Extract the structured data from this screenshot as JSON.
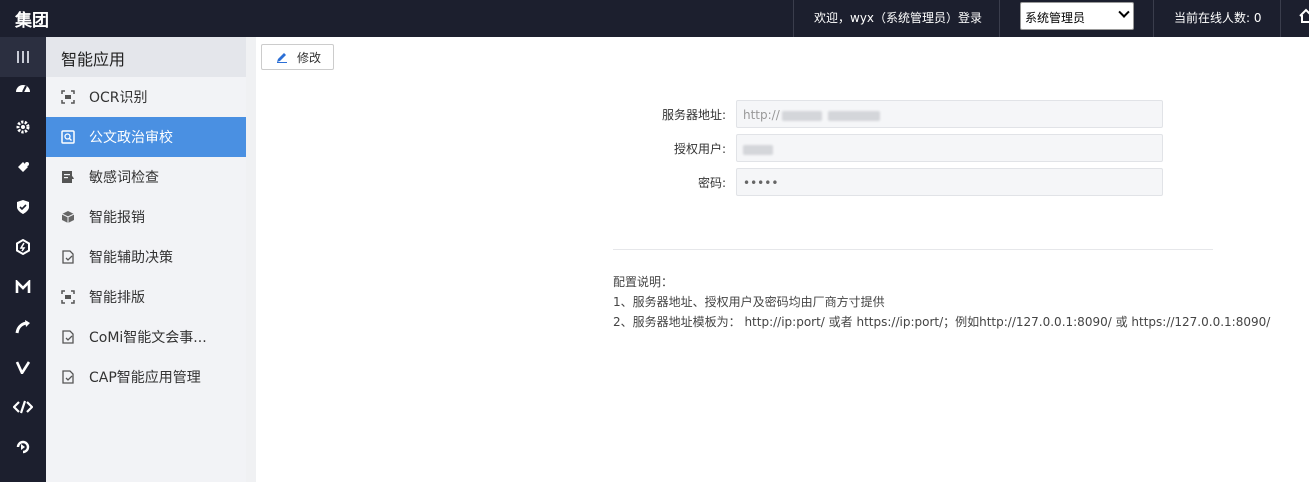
{
  "topbar": {
    "brand": "集团",
    "welcome": "欢迎，wyx（系统管理员）登录",
    "role_select": {
      "selected": "系统管理员"
    },
    "online_count": "当前在线人数: 0"
  },
  "iconbar": {
    "icons": [
      "menu-icon",
      "dashboard-icon",
      "settings-gear-icon",
      "puzzle-icon",
      "shield-check-icon",
      "hexagon-icon",
      "m-letter-icon",
      "arrow-curve-icon",
      "v-letter-icon",
      "code-slash-icon",
      "arrow-cycle-icon"
    ]
  },
  "sidenav": {
    "title": "智能应用",
    "items": [
      {
        "label": "OCR识别",
        "icon": "scan-icon"
      },
      {
        "label": "公文政治审校",
        "icon": "search-doc-icon",
        "active": true
      },
      {
        "label": "敏感词检查",
        "icon": "alert-doc-icon"
      },
      {
        "label": "智能报销",
        "icon": "cube-icon"
      },
      {
        "label": "智能辅助决策",
        "icon": "doc-check-icon"
      },
      {
        "label": "智能排版",
        "icon": "scan-icon"
      },
      {
        "label": "CoMi智能文会事...",
        "icon": "doc-check-icon"
      },
      {
        "label": "CAP智能应用管理",
        "icon": "doc-check-icon"
      }
    ],
    "active_color": "#4a90e2"
  },
  "toolbar": {
    "edit_label": "修改"
  },
  "form": {
    "server_label": "服务器地址:",
    "server_value": "http://",
    "user_label": "授权用户:",
    "password_label": "密码:",
    "password_value": "•••••"
  },
  "notes": {
    "title": "配置说明：",
    "line1": "1、服务器地址、授权用户及密码均由厂商方寸提供",
    "line2": "2、服务器地址模板为： http://ip:port/ 或者 https://ip:port/；例如http://127.0.0.1:8090/ 或 https://127.0.0.1:8090/"
  }
}
